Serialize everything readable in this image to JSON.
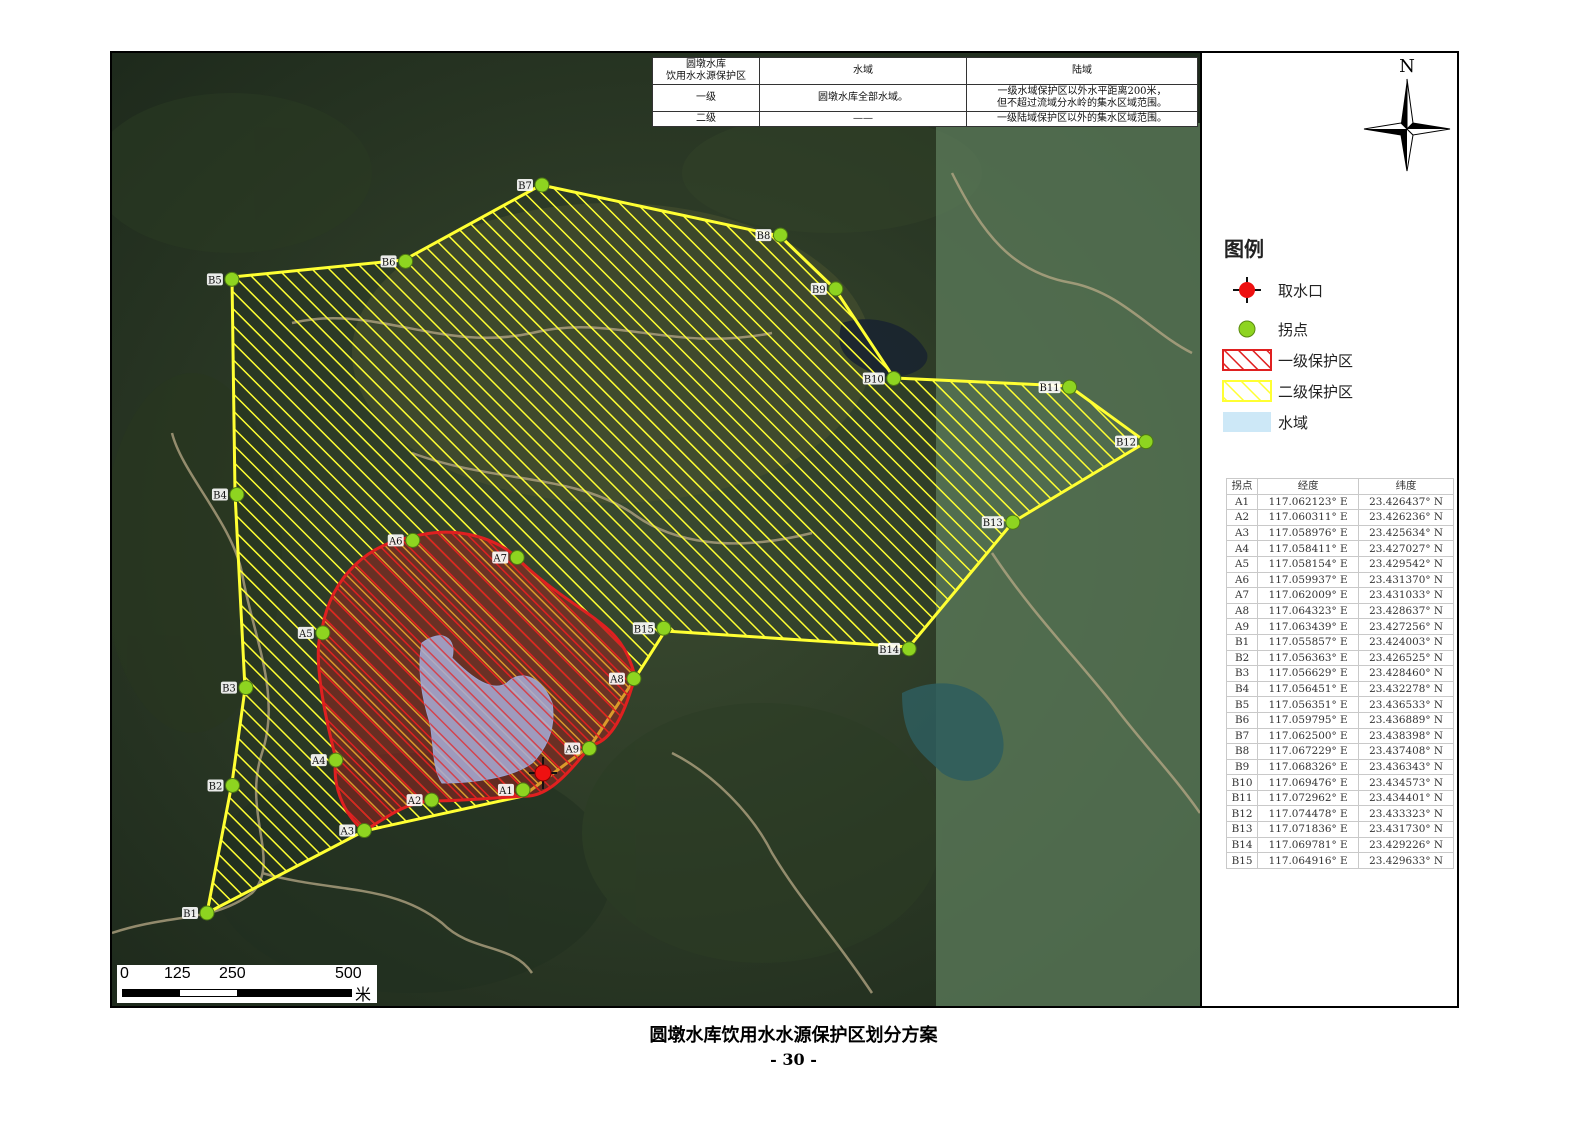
{
  "zone_table": {
    "header": [
      "圆墩水库\n饮用水水源保护区",
      "水域",
      "陆域"
    ],
    "rows": [
      [
        "一级",
        "圆墩水库全部水域。",
        "一级水域保护区以外水平距离200米，\n但不超过流域分水岭的集水区域范围。"
      ],
      [
        "二级",
        "——",
        "一级陆域保护区以外的集水区域范围。"
      ]
    ]
  },
  "north_label": "N",
  "legend": {
    "title": "图例",
    "items": [
      {
        "label": "取水口",
        "symbol": "intake-icon"
      },
      {
        "label": "拐点",
        "symbol": "point-icon"
      },
      {
        "label": "一级保护区",
        "symbol": "red-hatch",
        "color": "#e02020"
      },
      {
        "label": "二级保护区",
        "symbol": "yellow-hatch",
        "color": "#ffff33"
      },
      {
        "label": "水域",
        "symbol": "water-fill",
        "color": "#cde8f7"
      }
    ]
  },
  "coord_table": {
    "headers": [
      "拐点",
      "经度",
      "纬度"
    ],
    "rows": [
      [
        "A1",
        "117.062123° E",
        "23.426437° N"
      ],
      [
        "A2",
        "117.060311° E",
        "23.426236° N"
      ],
      [
        "A3",
        "117.058976° E",
        "23.425634° N"
      ],
      [
        "A4",
        "117.058411° E",
        "23.427027° N"
      ],
      [
        "A5",
        "117.058154° E",
        "23.429542° N"
      ],
      [
        "A6",
        "117.059937° E",
        "23.431370° N"
      ],
      [
        "A7",
        "117.062009° E",
        "23.431033° N"
      ],
      [
        "A8",
        "117.064323° E",
        "23.428637° N"
      ],
      [
        "A9",
        "117.063439° E",
        "23.427256° N"
      ],
      [
        "B1",
        "117.055857° E",
        "23.424003° N"
      ],
      [
        "B2",
        "117.056363° E",
        "23.426525° N"
      ],
      [
        "B3",
        "117.056629° E",
        "23.428460° N"
      ],
      [
        "B4",
        "117.056451° E",
        "23.432278° N"
      ],
      [
        "B5",
        "117.056351° E",
        "23.436533° N"
      ],
      [
        "B6",
        "117.059795° E",
        "23.436889° N"
      ],
      [
        "B7",
        "117.062500° E",
        "23.438398° N"
      ],
      [
        "B8",
        "117.067229° E",
        "23.437408° N"
      ],
      [
        "B9",
        "117.068326° E",
        "23.436343° N"
      ],
      [
        "B10",
        "117.069476° E",
        "23.434573° N"
      ],
      [
        "B11",
        "117.072962° E",
        "23.434401° N"
      ],
      [
        "B12",
        "117.074478° E",
        "23.433323° N"
      ],
      [
        "B13",
        "117.071836° E",
        "23.431730° N"
      ],
      [
        "B14",
        "117.069781° E",
        "23.429226° N"
      ],
      [
        "B15",
        "117.064916° E",
        "23.429633° N"
      ]
    ]
  },
  "scale_bar": {
    "ticks": [
      "0",
      "125",
      "250",
      "500"
    ],
    "unit": "米"
  },
  "caption": "圆墩水库饮用水水源保护区划分方案",
  "page_number": "- 30 -"
}
